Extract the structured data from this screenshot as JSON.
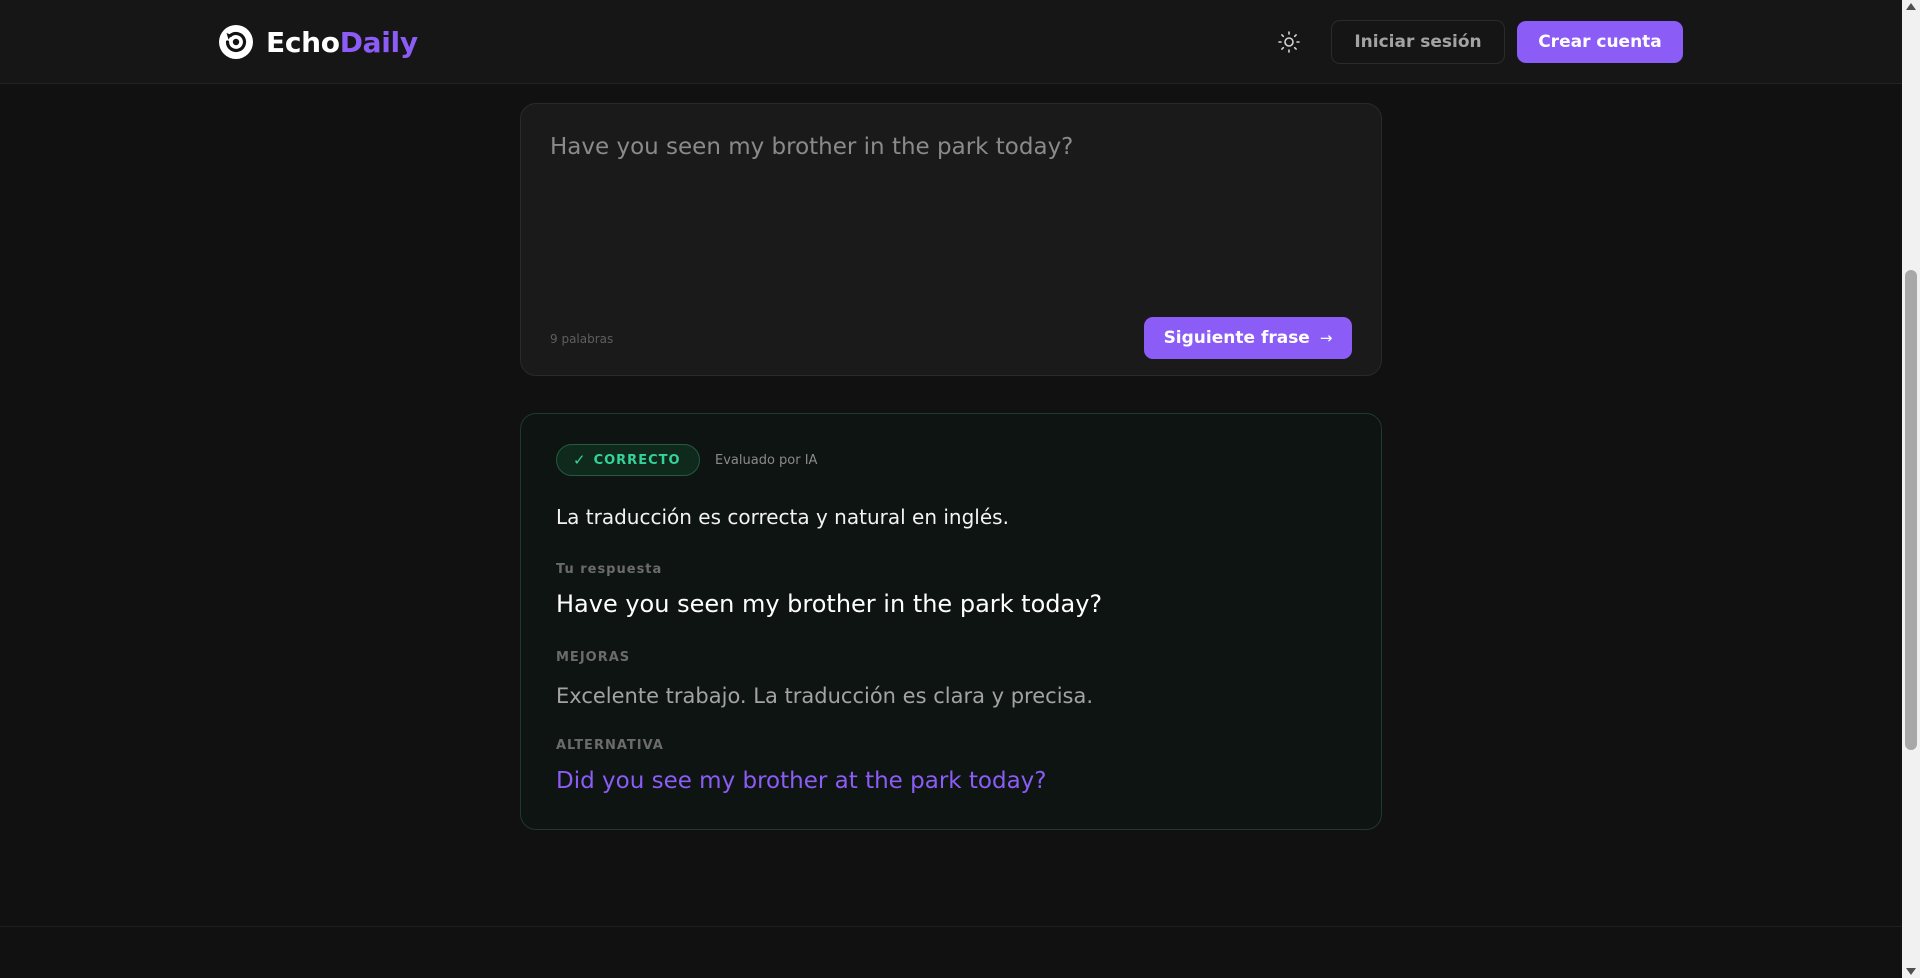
{
  "header": {
    "brand": {
      "part1": "Echo",
      "part2": "Daily"
    },
    "theme_toggle_icon": "sun-icon",
    "login_label": "Iniciar sesión",
    "signup_label": "Crear cuenta"
  },
  "practice": {
    "sentence": "Have you seen my brother in the park today?",
    "word_count": "9 palabras",
    "next_label": "Siguiente frase",
    "next_icon": "→"
  },
  "result": {
    "status_icon": "✓",
    "status": "CORRECTO",
    "evaluated_by": "Evaluado por IA",
    "feedback": "La traducción es correcta y natural en inglés.",
    "answer_label": "Tu respuesta",
    "answer": "Have you seen my brother in the park today?",
    "improvements_label": "MEJORAS",
    "improvements": "Excelente trabajo. La traducción es clara y precisa.",
    "alternative_label": "ALTERNATIVA",
    "alternative": "Did you see my brother at the park today?"
  },
  "colors": {
    "accent": "#8b5cf6",
    "success": "#34d399",
    "background": "#111111"
  }
}
